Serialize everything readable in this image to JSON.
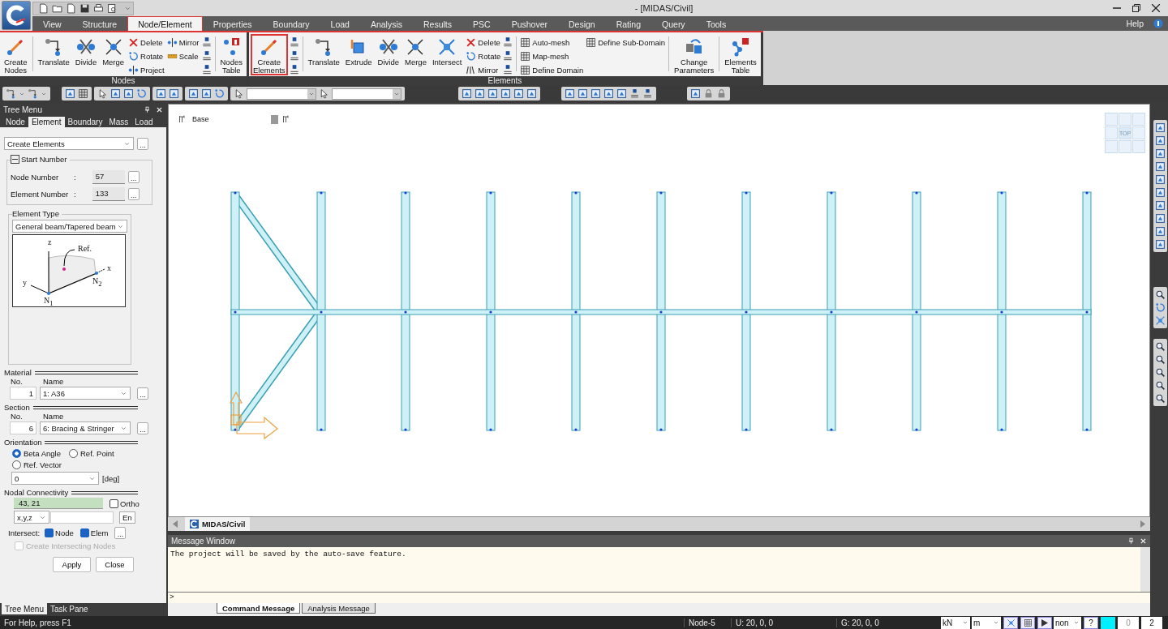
{
  "window": {
    "title": "- [MIDAS/Civil]",
    "help": "Help"
  },
  "menu_tabs": [
    {
      "label": "View",
      "selected": false
    },
    {
      "label": "Structure",
      "selected": false
    },
    {
      "label": "Node/Element",
      "selected": true
    },
    {
      "label": "Properties",
      "selected": false
    },
    {
      "label": "Boundary",
      "selected": false
    },
    {
      "label": "Load",
      "selected": false
    },
    {
      "label": "Analysis",
      "selected": false
    },
    {
      "label": "Results",
      "selected": false
    },
    {
      "label": "PSC",
      "selected": false
    },
    {
      "label": "Pushover",
      "selected": false
    },
    {
      "label": "Design",
      "selected": false
    },
    {
      "label": "Rating",
      "selected": false
    },
    {
      "label": "Query",
      "selected": false
    },
    {
      "label": "Tools",
      "selected": false
    }
  ],
  "ribbon": {
    "groups": [
      {
        "label": "Nodes",
        "items": [
          {
            "kind": "large",
            "label": "Create Nodes",
            "selected": false
          },
          {
            "kind": "separator"
          },
          {
            "kind": "large",
            "label": "Translate",
            "selected": false
          },
          {
            "kind": "large",
            "label": "Divide",
            "selected": false
          },
          {
            "kind": "large",
            "label": "Merge",
            "selected": false
          },
          {
            "kind": "stack",
            "labels": [
              "Delete",
              "Rotate",
              "Project"
            ]
          },
          {
            "kind": "stack",
            "labels": [
              "Mirror",
              "Scale"
            ]
          },
          {
            "kind": "icons"
          },
          {
            "kind": "separator"
          },
          {
            "kind": "large",
            "label": "Nodes Table",
            "selected": false
          }
        ]
      },
      {
        "label": "Elements",
        "items": [
          {
            "kind": "large",
            "label": "Create Elements",
            "selected": true
          },
          {
            "kind": "icons"
          },
          {
            "kind": "separator"
          },
          {
            "kind": "large",
            "label": "Translate",
            "selected": false
          },
          {
            "kind": "large",
            "label": "Extrude",
            "selected": false
          },
          {
            "kind": "large",
            "label": "Divide",
            "selected": false
          },
          {
            "kind": "large",
            "label": "Merge",
            "selected": false
          },
          {
            "kind": "large",
            "label": "Intersect",
            "selected": false
          },
          {
            "kind": "stack",
            "labels": [
              "Delete",
              "Rotate",
              "Mirror"
            ]
          },
          {
            "kind": "icons"
          },
          {
            "kind": "separator"
          },
          {
            "kind": "stack",
            "labels": [
              "Auto-mesh",
              "Map-mesh",
              "Define Domain"
            ]
          },
          {
            "kind": "stack",
            "labels": [
              "Define Sub-Domain"
            ]
          },
          {
            "kind": "separator"
          },
          {
            "kind": "large",
            "label": "Change Parameters",
            "selected": false
          },
          {
            "kind": "separator"
          },
          {
            "kind": "large",
            "label": "Elements Table",
            "selected": false
          }
        ]
      }
    ]
  },
  "tree_menu": {
    "title": "Tree Menu",
    "tabs": [
      {
        "label": "Node",
        "selected": false
      },
      {
        "label": "Element",
        "selected": true
      },
      {
        "label": "Boundary",
        "selected": false
      },
      {
        "label": "Mass",
        "selected": false
      },
      {
        "label": "Load",
        "selected": false
      }
    ],
    "command": "Create Elements",
    "command_more": "...",
    "start_number": {
      "title": "Start Number",
      "fields": [
        {
          "label": "Node Number",
          "colon": ":",
          "value": "57",
          "more": "..."
        },
        {
          "label": "Element Number",
          "colon": ":",
          "value": "133",
          "more": "..."
        }
      ]
    },
    "element_type": {
      "title": "Element Type",
      "value": "General beam/Tapered beam",
      "diagram_labels": {
        "z": "z",
        "ref": "Ref.",
        "x": "x",
        "y": "y",
        "n1": "N$_{1}$",
        "n2": "N$_{2}$"
      }
    },
    "material": {
      "title": "Material",
      "no_header": "No.",
      "name_header": "Name",
      "no": "1",
      "name": "1: A36",
      "more": "..."
    },
    "section": {
      "title": "Section",
      "no_header": "No.",
      "name_header": "Name",
      "no": "6",
      "name": "6: Bracing & Stringer",
      "more": "..."
    },
    "orientation": {
      "title": "Orientation",
      "options": [
        {
          "label": "Beta Angle",
          "selected": true
        },
        {
          "label": "Ref. Point",
          "selected": false
        },
        {
          "label": "Ref. Vector",
          "selected": false
        }
      ],
      "angle": "0",
      "unit": "[deg]"
    },
    "nodal_connectivity": {
      "title": "Nodal Connectivity",
      "value": "43, 21",
      "ortho": {
        "label": "Ortho",
        "checked": false
      },
      "coords": "x,y,z",
      "enter": "En"
    },
    "intersect": {
      "label": "Intersect:",
      "options": [
        {
          "label": "Node",
          "checked": true
        },
        {
          "label": "Elem",
          "checked": true
        }
      ],
      "more": "..."
    },
    "create_intersecting": {
      "label": "Create Intersecting Nodes",
      "checked": false,
      "disabled": true
    },
    "buttons": [
      "Apply",
      "Close"
    ],
    "bottom_tabs": [
      {
        "label": "Tree Menu",
        "selected": true
      },
      {
        "label": "Task Pane",
        "selected": false
      }
    ]
  },
  "canvas": {
    "layer": "Base",
    "view_cube": "TOP",
    "tabs": [
      {
        "label": "MIDAS/Civil",
        "selected": true
      }
    ]
  },
  "message_window": {
    "title": "Message Window",
    "lines": [
      "The project will be saved by the auto-save feature."
    ],
    "prompt": ">",
    "tabs": [
      {
        "label": "Command Message",
        "selected": true
      },
      {
        "label": "Analysis Message",
        "selected": false
      }
    ]
  },
  "status_bar": {
    "help": "For Help, press F1",
    "node": "Node-5",
    "ucs": "U: 20, 0, 0",
    "global": "G: 20, 0, 0",
    "force_unit": "kN",
    "length_unit": "m",
    "filter": "non",
    "help_button": "?",
    "spin_a": "0",
    "spin_b": "2"
  }
}
